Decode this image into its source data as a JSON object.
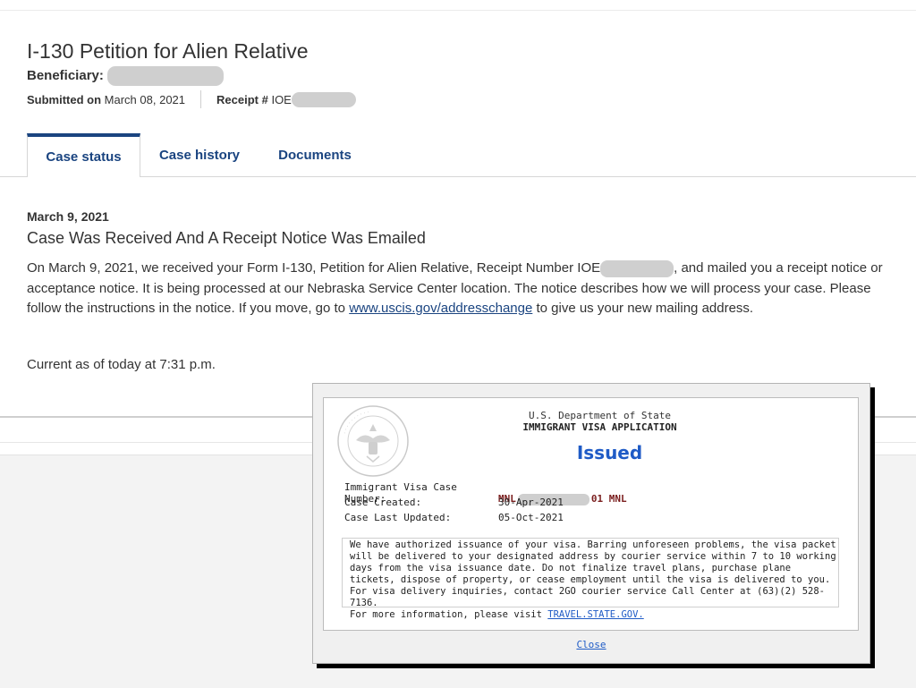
{
  "page": {
    "title": "I-130 Petition for Alien Relative",
    "beneficiary_label": "Beneficiary:",
    "submitted_label": "Submitted on",
    "submitted_date": "March 08, 2021",
    "receipt_label": "Receipt #",
    "receipt_prefix": "IOE"
  },
  "tabs": [
    {
      "label": "Case status",
      "active": true
    },
    {
      "label": "Case history",
      "active": false
    },
    {
      "label": "Documents",
      "active": false
    }
  ],
  "case": {
    "date": "March 9, 2021",
    "status_title": "Case Was Received And A Receipt Notice Was Emailed",
    "desc_part1": "On March 9, 2021, we received your Form I-130, Petition for Alien Relative, Receipt Number IOE",
    "desc_part2": ", and mailed you a receipt notice or acceptance notice. It is being processed at our Nebraska Service Center location. The notice describes how we will process your case. Please follow the instructions in the notice. If you move, go to ",
    "link": "www.uscis.gov/addresschange",
    "desc_part3": " to give us your new mailing address.",
    "current_as_of": "Current as of today at 7:31 p.m."
  },
  "visa_modal": {
    "department": "U.S. Department of State",
    "application_type": "IMMIGRANT VISA APPLICATION",
    "status": "Issued",
    "case_number_label": "Immigrant Visa Case Number:",
    "case_number_prefix": "MNL",
    "case_number_suffix": "01 MNL",
    "created_label": "Case Created:",
    "created_value": "30-Apr-2021",
    "updated_label": "Case Last Updated:",
    "updated_value": "05-Oct-2021",
    "notice_text": "We have authorized issuance of your visa. Barring unforeseen problems, the visa packet will be delivered to your designated address by courier service within 7 to 10 working days from the visa issuance date. Do not finalize travel plans, purchase plane tickets, dispose of property, or cease employment until the visa is delivered to you. For visa delivery inquiries, contact 2GO courier service Call Center at (63)(2) 528-7136.",
    "more_info_text": "For more information, please visit ",
    "more_info_link": "TRAVEL.STATE.GOV.",
    "close_label": "Close",
    "seal_icon": "department-of-state-seal-icon"
  }
}
